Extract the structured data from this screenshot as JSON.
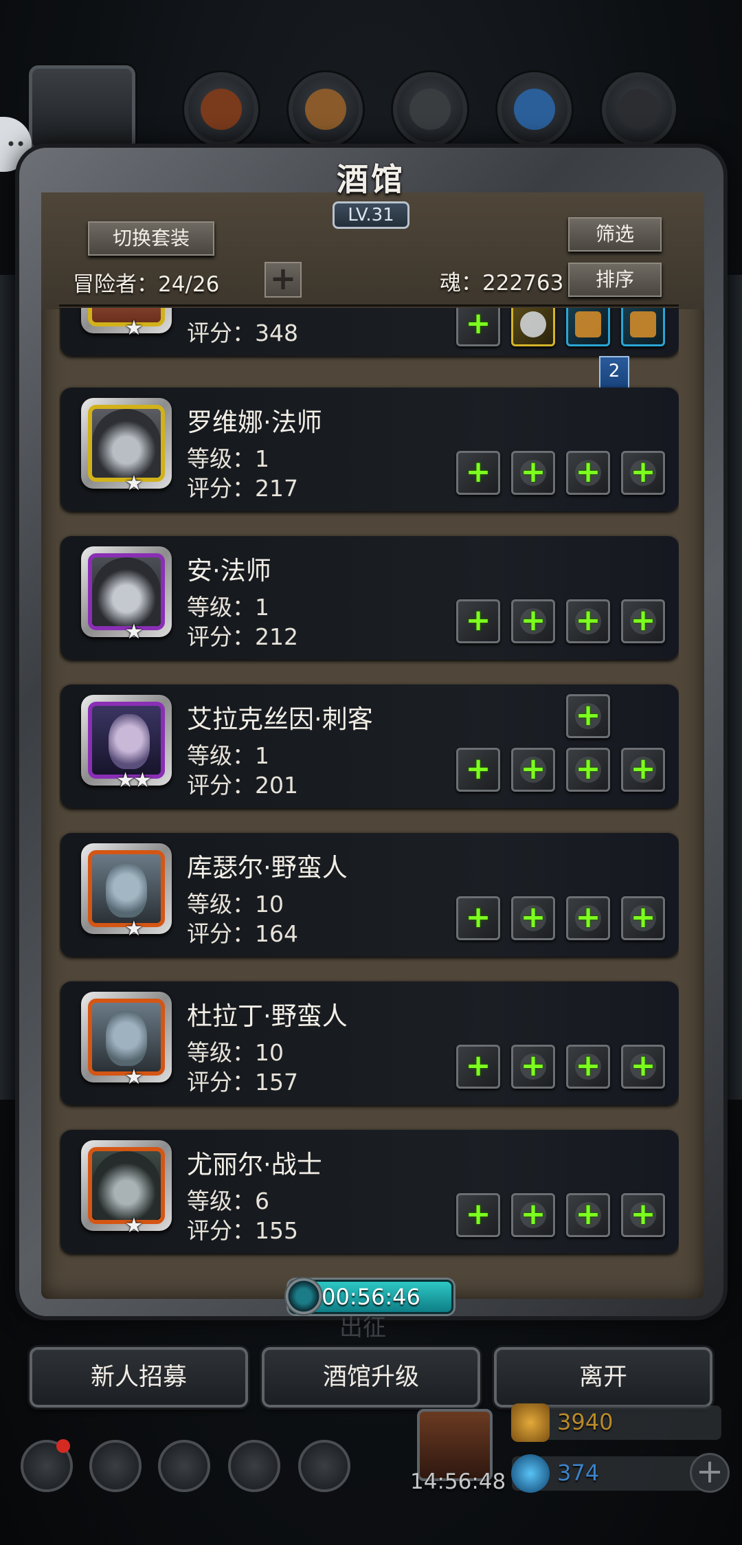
{
  "window": {
    "title": "酒馆",
    "level": "LV.31"
  },
  "header": {
    "switch_outfit_label": "切换套装",
    "filter_label": "筛选",
    "sort_label": "排序",
    "adventurers_label": "冒险者：24/26",
    "soul_label": "魂：222763",
    "add_slot_symbol": "+"
  },
  "partial_card": {
    "score": "评分：348",
    "badge_number": "2"
  },
  "heroes": [
    {
      "name": "罗维娜·法师",
      "level": "等级：1",
      "score": "评分：217",
      "stars": "★",
      "frame": "gold"
    },
    {
      "name": "安·法师",
      "level": "等级：1",
      "score": "评分：212",
      "stars": "★",
      "frame": "purple"
    },
    {
      "name": "艾拉克丝因·刺客",
      "level": "等级：1",
      "score": "评分：201",
      "stars": "★★",
      "frame": "purple"
    },
    {
      "name": "库瑟尔·野蛮人",
      "level": "等级：10",
      "score": "评分：164",
      "stars": "★",
      "frame": "orange"
    },
    {
      "name": "杜拉丁·野蛮人",
      "level": "等级：10",
      "score": "评分：157",
      "stars": "★",
      "frame": "orange"
    },
    {
      "name": "尤丽尔·战士",
      "level": "等级：6",
      "score": "评分：155",
      "stars": "★",
      "frame": "orange"
    }
  ],
  "timer": "00:56:46",
  "behind_text": "出征",
  "buttons": {
    "recruit": "新人招募",
    "upgrade": "酒馆升级",
    "leave": "离开"
  },
  "footer": {
    "clock": "14:56:48",
    "gold": "3940",
    "gems": "374"
  },
  "colors": {
    "gold_frame": "#d2b21a",
    "purple_frame": "#8a2fb5",
    "orange_frame": "#d55614",
    "plus_green": "#7cff1f",
    "gold_text": "#b98a2a",
    "gem_text": "#3c82c8"
  }
}
